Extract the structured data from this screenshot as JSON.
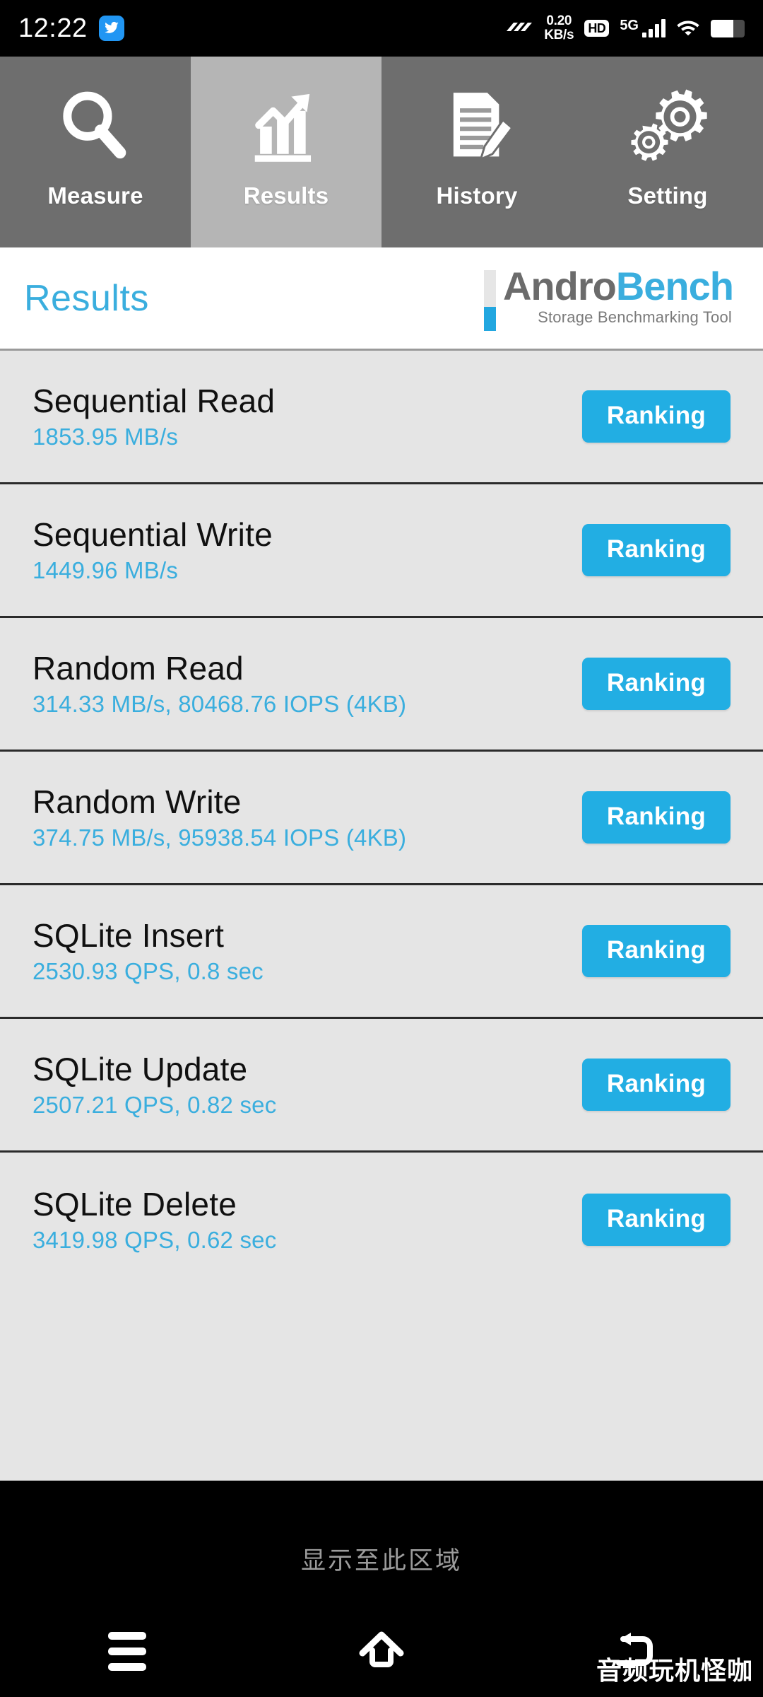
{
  "status_bar": {
    "clock": "12:22",
    "app_icon": "bird-app-icon",
    "speed_icon": "speed-lines-icon",
    "net_speed_value": "0.20",
    "net_speed_unit": "KB/s",
    "hd_label": "HD",
    "network_type": "5G",
    "signal_bars": 4,
    "wifi_icon": "wifi-icon",
    "battery_icon": "battery-icon",
    "battery_level_percent": 66
  },
  "tabs": [
    {
      "label": "Measure",
      "icon": "magnifier-icon",
      "selected": false
    },
    {
      "label": "Results",
      "icon": "bar-chart-arrow-icon",
      "selected": true
    },
    {
      "label": "History",
      "icon": "document-pen-icon",
      "selected": false
    },
    {
      "label": "Setting",
      "icon": "gears-icon",
      "selected": false
    }
  ],
  "header": {
    "title": "Results",
    "brand_primary": "Andro",
    "brand_secondary": "Bench",
    "brand_tagline": "Storage Benchmarking Tool"
  },
  "results": [
    {
      "name": "Sequential Read",
      "value": "1853.95 MB/s",
      "action": "Ranking"
    },
    {
      "name": "Sequential Write",
      "value": "1449.96 MB/s",
      "action": "Ranking"
    },
    {
      "name": "Random Read",
      "value": "314.33 MB/s, 80468.76 IOPS (4KB)",
      "action": "Ranking"
    },
    {
      "name": "Random Write",
      "value": "374.75 MB/s, 95938.54 IOPS (4KB)",
      "action": "Ranking"
    },
    {
      "name": "SQLite Insert",
      "value": "2530.93 QPS, 0.8 sec",
      "action": "Ranking"
    },
    {
      "name": "SQLite Update",
      "value": "2507.21 QPS, 0.82 sec",
      "action": "Ranking"
    },
    {
      "name": "SQLite Delete",
      "value": "3419.98 QPS, 0.62 sec",
      "action": "Ranking"
    }
  ],
  "bottom": {
    "show_area_label": "显示至此区域",
    "watermark": "音频玩机怪咖",
    "nav": [
      {
        "name": "recents-button",
        "icon": "hamburger-icon"
      },
      {
        "name": "home-button",
        "icon": "home-icon"
      },
      {
        "name": "back-button",
        "icon": "back-undo-icon"
      }
    ]
  },
  "colors": {
    "accent_blue": "#3aaede",
    "button_blue": "#22aee3",
    "tab_unselected": "#6e6e6e",
    "tab_selected": "#b5b5b5",
    "list_background": "#e5e5e5",
    "brand_gray": "#6b6b6b"
  }
}
